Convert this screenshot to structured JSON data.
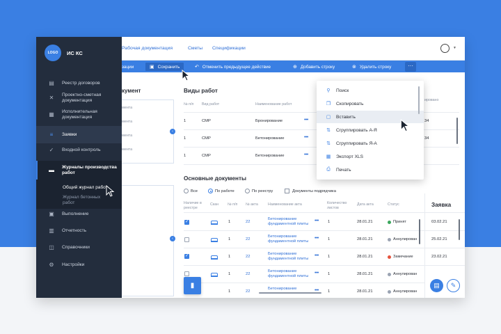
{
  "colors": {
    "accent": "#3a7fe3",
    "sidebar": "#232d3d",
    "green": "#3aa65c",
    "gray": "#9aa3b2",
    "red": "#e5533d"
  },
  "app": {
    "logo": "LOGO",
    "title": "ИС КС"
  },
  "sidebar": {
    "items": [
      {
        "label": "Реестр договоров",
        "icon": "list-icon"
      },
      {
        "label": "Проектно-сметная документация",
        "icon": "tools-icon"
      },
      {
        "label": "Исполнительная документация",
        "icon": "document-icon"
      },
      {
        "label": "Заявки",
        "icon": "edit-list-icon"
      },
      {
        "label": "Входной контроль",
        "icon": "check-icon"
      },
      {
        "label": "Журналы производства работ",
        "icon": "folder-icon"
      },
      {
        "label": "Выполнение",
        "icon": "task-icon"
      },
      {
        "label": "Отчетность",
        "icon": "chart-icon"
      },
      {
        "label": "Справочники",
        "icon": "book-icon"
      },
      {
        "label": "Настройки",
        "icon": "gear-icon"
      }
    ],
    "submenu": [
      "Общий журнал работ",
      "Журнал бетонных работ"
    ]
  },
  "topnav": {
    "links": [
      "Рабочая документация",
      "Сметы",
      "Спецификации"
    ]
  },
  "toolbar": {
    "partial": "зации",
    "save": "Сохранить",
    "undo": "Отменить предыдущее действие",
    "add_row": "Добавить строку",
    "delete_row": "Удалить строку",
    "more": "···"
  },
  "left_card": {
    "title": "кумент",
    "rows": [
      "мента",
      "мента",
      "мента",
      "мента"
    ]
  },
  "work_types": {
    "title": "Виды работ",
    "headers": [
      "№ п/п",
      "Вид работ",
      "Наименование работ"
    ],
    "right_header": "ировано",
    "rows": [
      {
        "n": "1",
        "type": "СМР",
        "name": "Бронирование",
        "right": "34"
      },
      {
        "n": "1",
        "type": "СМР",
        "name": "Бетонирование",
        "right": "34"
      },
      {
        "n": "1",
        "type": "СМР",
        "name": "Бетонирование",
        "right": ""
      }
    ]
  },
  "main_docs": {
    "title": "Основные документы",
    "filters": [
      "Все",
      "По работе",
      "По реестру",
      "Документы подрядчика"
    ],
    "headers": [
      "Наличие в реестре",
      "Скан",
      "№ п/п",
      "№ акта",
      "Наименование акта",
      "Количество листов",
      "Дата акта",
      "Статус"
    ],
    "rows": [
      {
        "n": "1",
        "act": "22",
        "name": "Бетонирование фундаментной плиты",
        "sheets": "1",
        "date": "28.01.21",
        "status": "Принят",
        "color": "#3aa65c",
        "checked": true
      },
      {
        "n": "1",
        "act": "22",
        "name": "Бетонирование фундаментной плиты",
        "sheets": "1",
        "date": "28.01.21",
        "status": "Аннулирован",
        "color": "#9aa3b2",
        "checked": false
      },
      {
        "n": "1",
        "act": "22",
        "name": "Бетонирование фундаментной плиты",
        "sheets": "1",
        "date": "28.01.21",
        "status": "Замечание",
        "color": "#e5533d",
        "checked": true
      },
      {
        "n": "1",
        "act": "22",
        "name": "Бетонирование фундаментной плиты",
        "sheets": "1",
        "date": "28.01.21",
        "status": "Аннулирован",
        "color": "#9aa3b2",
        "checked": false
      },
      {
        "n": "1",
        "act": "22",
        "name": "Бетонирование",
        "sheets": "1",
        "date": "28.01.21",
        "status": "Аннулирован",
        "color": "#9aa3b2",
        "checked": false
      }
    ]
  },
  "requests": {
    "title": "Заявка",
    "dates": [
      "03.02.21",
      "25.02.21",
      "23.02.21"
    ]
  },
  "menu": {
    "items": [
      {
        "label": "Поиск",
        "icon": "search-icon"
      },
      {
        "label": "Скопировать",
        "icon": "copy-icon"
      },
      {
        "label": "Вставить",
        "icon": "paste-icon"
      },
      {
        "label": "Сгруппировать А-Я",
        "icon": "sort-az-icon"
      },
      {
        "label": "Сгруппировать Я-А",
        "icon": "sort-za-icon"
      },
      {
        "label": "Экспорт XLS",
        "icon": "excel-icon"
      },
      {
        "label": "Печать",
        "icon": "print-icon"
      }
    ]
  }
}
